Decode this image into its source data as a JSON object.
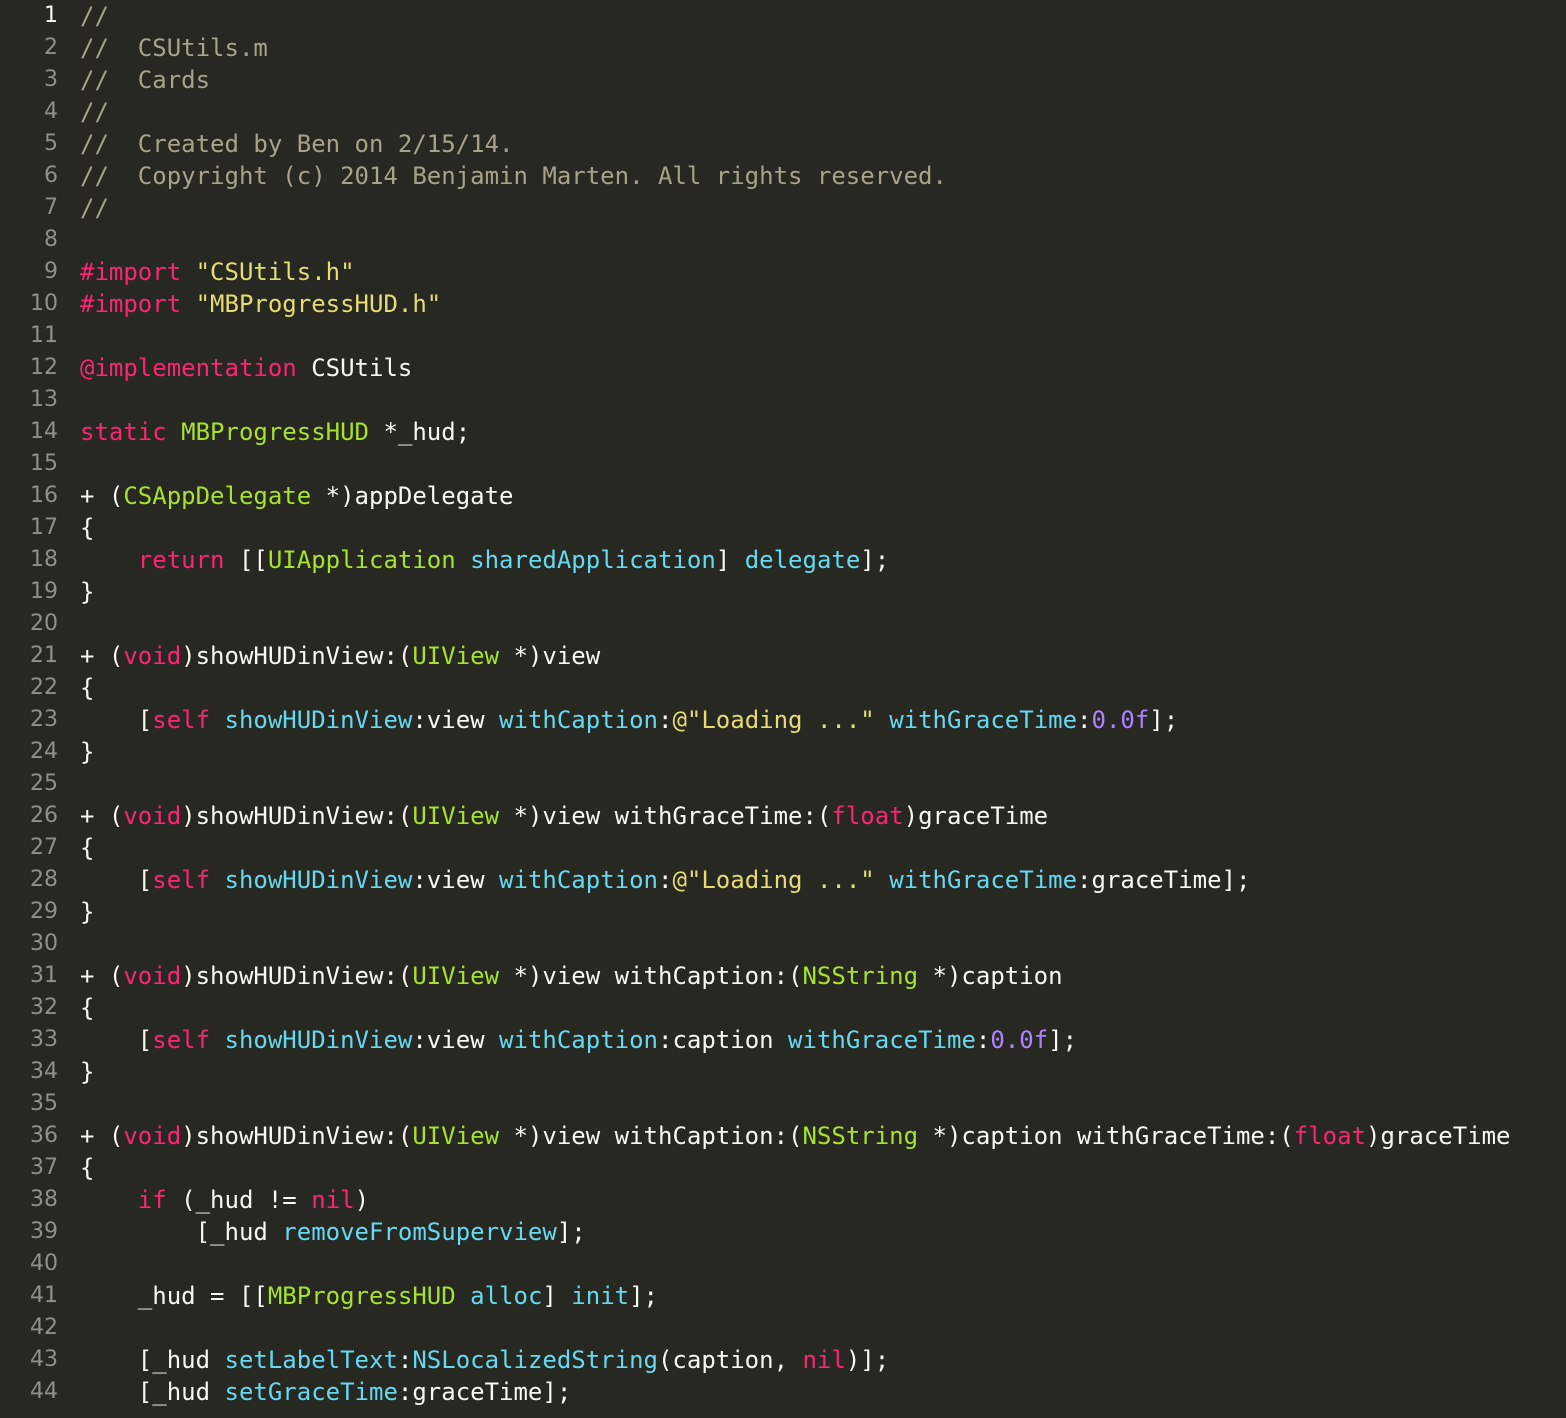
{
  "editor": {
    "theme": {
      "background": "#272822",
      "plain": "#f8f8f2",
      "comment": "#a6a28c",
      "keyword": "#f92672",
      "string": "#e6db74",
      "type": "#a6e22e",
      "method": "#66d9ef",
      "number": "#ae81ff",
      "gutter": "#90908a"
    },
    "current_line": 1,
    "lines": [
      {
        "n": "1",
        "tokens": [
          [
            "comment",
            "//"
          ]
        ]
      },
      {
        "n": "2",
        "tokens": [
          [
            "comment",
            "//  CSUtils.m"
          ]
        ]
      },
      {
        "n": "3",
        "tokens": [
          [
            "comment",
            "//  Cards"
          ]
        ]
      },
      {
        "n": "4",
        "tokens": [
          [
            "comment",
            "//"
          ]
        ]
      },
      {
        "n": "5",
        "tokens": [
          [
            "comment",
            "//  Created by Ben on 2/15/14."
          ]
        ]
      },
      {
        "n": "6",
        "tokens": [
          [
            "comment",
            "//  Copyright (c) 2014 Benjamin Marten. All rights reserved."
          ]
        ]
      },
      {
        "n": "7",
        "tokens": [
          [
            "comment",
            "//"
          ]
        ]
      },
      {
        "n": "8",
        "tokens": []
      },
      {
        "n": "9",
        "tokens": [
          [
            "keyword",
            "#import"
          ],
          [
            "plain",
            " "
          ],
          [
            "string",
            "\"CSUtils.h\""
          ]
        ]
      },
      {
        "n": "10",
        "tokens": [
          [
            "keyword",
            "#import"
          ],
          [
            "plain",
            " "
          ],
          [
            "string",
            "\"MBProgressHUD.h\""
          ]
        ]
      },
      {
        "n": "11",
        "tokens": []
      },
      {
        "n": "12",
        "tokens": [
          [
            "keyword",
            "@implementation"
          ],
          [
            "plain",
            " CSUtils"
          ]
        ]
      },
      {
        "n": "13",
        "tokens": []
      },
      {
        "n": "14",
        "tokens": [
          [
            "keyword",
            "static"
          ],
          [
            "plain",
            " "
          ],
          [
            "type",
            "MBProgressHUD"
          ],
          [
            "plain",
            " *_hud;"
          ]
        ]
      },
      {
        "n": "15",
        "tokens": []
      },
      {
        "n": "16",
        "tokens": [
          [
            "plain",
            "+ ("
          ],
          [
            "type",
            "CSAppDelegate"
          ],
          [
            "plain",
            " *)appDelegate"
          ]
        ]
      },
      {
        "n": "17",
        "tokens": [
          [
            "plain",
            "{"
          ]
        ]
      },
      {
        "n": "18",
        "tokens": [
          [
            "plain",
            "    "
          ],
          [
            "keyword",
            "return"
          ],
          [
            "plain",
            " [["
          ],
          [
            "type",
            "UIApplication"
          ],
          [
            "plain",
            " "
          ],
          [
            "method",
            "sharedApplication"
          ],
          [
            "plain",
            "] "
          ],
          [
            "method",
            "delegate"
          ],
          [
            "plain",
            "];"
          ]
        ]
      },
      {
        "n": "19",
        "tokens": [
          [
            "plain",
            "}"
          ]
        ]
      },
      {
        "n": "20",
        "tokens": []
      },
      {
        "n": "21",
        "tokens": [
          [
            "plain",
            "+ ("
          ],
          [
            "keyword",
            "void"
          ],
          [
            "plain",
            ")showHUDinView:("
          ],
          [
            "type",
            "UIView"
          ],
          [
            "plain",
            " *)view"
          ]
        ]
      },
      {
        "n": "22",
        "tokens": [
          [
            "plain",
            "{"
          ]
        ]
      },
      {
        "n": "23",
        "tokens": [
          [
            "plain",
            "    ["
          ],
          [
            "keyword",
            "self"
          ],
          [
            "plain",
            " "
          ],
          [
            "method",
            "showHUDinView"
          ],
          [
            "plain",
            ":view "
          ],
          [
            "method",
            "withCaption"
          ],
          [
            "plain",
            ":"
          ],
          [
            "string",
            "@\"Loading ...\""
          ],
          [
            "plain",
            " "
          ],
          [
            "method",
            "withGraceTime"
          ],
          [
            "plain",
            ":"
          ],
          [
            "number",
            "0.0f"
          ],
          [
            "plain",
            "];"
          ]
        ]
      },
      {
        "n": "24",
        "tokens": [
          [
            "plain",
            "}"
          ]
        ]
      },
      {
        "n": "25",
        "tokens": []
      },
      {
        "n": "26",
        "tokens": [
          [
            "plain",
            "+ ("
          ],
          [
            "keyword",
            "void"
          ],
          [
            "plain",
            ")showHUDinView:("
          ],
          [
            "type",
            "UIView"
          ],
          [
            "plain",
            " *)view withGraceTime:("
          ],
          [
            "keyword",
            "float"
          ],
          [
            "plain",
            ")graceTime"
          ]
        ]
      },
      {
        "n": "27",
        "tokens": [
          [
            "plain",
            "{"
          ]
        ]
      },
      {
        "n": "28",
        "tokens": [
          [
            "plain",
            "    ["
          ],
          [
            "keyword",
            "self"
          ],
          [
            "plain",
            " "
          ],
          [
            "method",
            "showHUDinView"
          ],
          [
            "plain",
            ":view "
          ],
          [
            "method",
            "withCaption"
          ],
          [
            "plain",
            ":"
          ],
          [
            "string",
            "@\"Loading ...\""
          ],
          [
            "plain",
            " "
          ],
          [
            "method",
            "withGraceTime"
          ],
          [
            "plain",
            ":graceTime];"
          ]
        ]
      },
      {
        "n": "29",
        "tokens": [
          [
            "plain",
            "}"
          ]
        ]
      },
      {
        "n": "30",
        "tokens": []
      },
      {
        "n": "31",
        "tokens": [
          [
            "plain",
            "+ ("
          ],
          [
            "keyword",
            "void"
          ],
          [
            "plain",
            ")showHUDinView:("
          ],
          [
            "type",
            "UIView"
          ],
          [
            "plain",
            " *)view withCaption:("
          ],
          [
            "type",
            "NSString"
          ],
          [
            "plain",
            " *)caption"
          ]
        ]
      },
      {
        "n": "32",
        "tokens": [
          [
            "plain",
            "{"
          ]
        ]
      },
      {
        "n": "33",
        "tokens": [
          [
            "plain",
            "    ["
          ],
          [
            "keyword",
            "self"
          ],
          [
            "plain",
            " "
          ],
          [
            "method",
            "showHUDinView"
          ],
          [
            "plain",
            ":view "
          ],
          [
            "method",
            "withCaption"
          ],
          [
            "plain",
            ":caption "
          ],
          [
            "method",
            "withGraceTime"
          ],
          [
            "plain",
            ":"
          ],
          [
            "number",
            "0.0f"
          ],
          [
            "plain",
            "];"
          ]
        ]
      },
      {
        "n": "34",
        "tokens": [
          [
            "plain",
            "}"
          ]
        ]
      },
      {
        "n": "35",
        "tokens": []
      },
      {
        "n": "36",
        "tokens": [
          [
            "plain",
            "+ ("
          ],
          [
            "keyword",
            "void"
          ],
          [
            "plain",
            ")showHUDinView:("
          ],
          [
            "type",
            "UIView"
          ],
          [
            "plain",
            " *)view withCaption:("
          ],
          [
            "type",
            "NSString"
          ],
          [
            "plain",
            " *)caption withGraceTime:("
          ],
          [
            "keyword",
            "float"
          ],
          [
            "plain",
            ")graceTime"
          ]
        ]
      },
      {
        "n": "37",
        "tokens": [
          [
            "plain",
            "{"
          ]
        ]
      },
      {
        "n": "38",
        "tokens": [
          [
            "plain",
            "    "
          ],
          [
            "keyword",
            "if"
          ],
          [
            "plain",
            " (_hud != "
          ],
          [
            "keyword",
            "nil"
          ],
          [
            "plain",
            ")"
          ]
        ]
      },
      {
        "n": "39",
        "tokens": [
          [
            "plain",
            "        [_hud "
          ],
          [
            "method",
            "removeFromSuperview"
          ],
          [
            "plain",
            "];"
          ]
        ]
      },
      {
        "n": "40",
        "tokens": []
      },
      {
        "n": "41",
        "tokens": [
          [
            "plain",
            "    _hud = [["
          ],
          [
            "type",
            "MBProgressHUD"
          ],
          [
            "plain",
            " "
          ],
          [
            "method",
            "alloc"
          ],
          [
            "plain",
            "] "
          ],
          [
            "method",
            "init"
          ],
          [
            "plain",
            "];"
          ]
        ]
      },
      {
        "n": "42",
        "tokens": []
      },
      {
        "n": "43",
        "tokens": [
          [
            "plain",
            "    [_hud "
          ],
          [
            "method",
            "setLabelText"
          ],
          [
            "plain",
            ":"
          ],
          [
            "method",
            "NSLocalizedString"
          ],
          [
            "plain",
            "(caption, "
          ],
          [
            "keyword",
            "nil"
          ],
          [
            "plain",
            ")];"
          ]
        ]
      },
      {
        "n": "44",
        "tokens": [
          [
            "plain",
            "    [_hud "
          ],
          [
            "method",
            "setGraceTime"
          ],
          [
            "plain",
            ":graceTime];"
          ]
        ]
      }
    ]
  }
}
